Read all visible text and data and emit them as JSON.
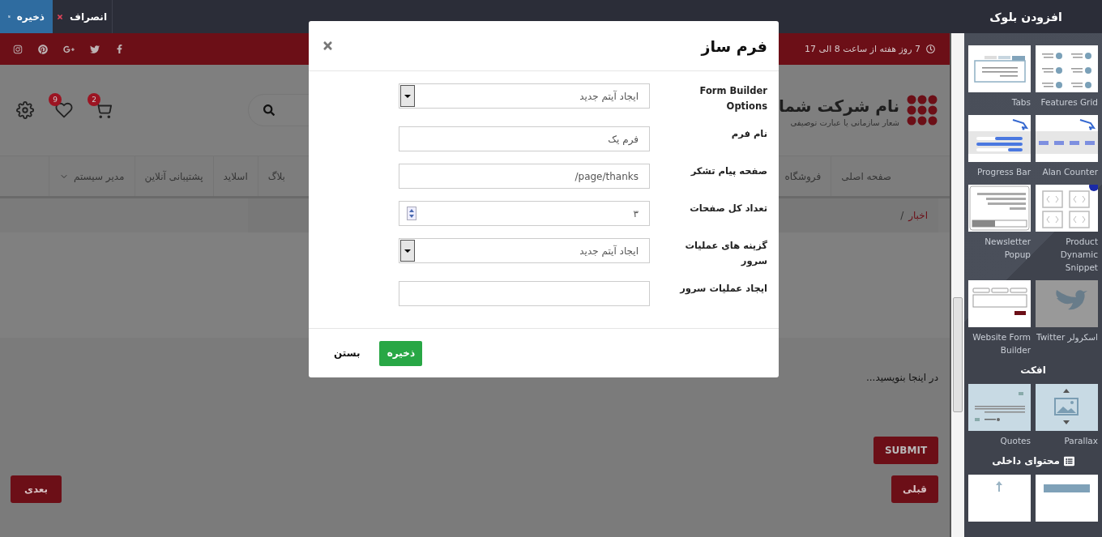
{
  "toolbar": {
    "save": "ذخیره",
    "cancel": "انصراف"
  },
  "topbar": {
    "hours": "7 روز هفته از ساعت 8 الی 17"
  },
  "header": {
    "logo_title": "نام شرکت شما",
    "logo_tagline": "شعار سازمانی یا عبارت توصیفی",
    "wishlist_count": "9",
    "cart_count": "2"
  },
  "nav": [
    {
      "label": "صفحه اصلی",
      "has_menu": false
    },
    {
      "label": "فروشگاه",
      "has_menu": false
    },
    {
      "label": "بلاگ",
      "has_menu": false
    },
    {
      "label": "اسلاید",
      "has_menu": false
    },
    {
      "label": "پشتیبانی آنلاین",
      "has_menu": false
    },
    {
      "label": "مدیر سیستم",
      "has_menu": true
    }
  ],
  "breadcrumb": {
    "label": "اخبار",
    "separator": "/"
  },
  "editor_text": "در اینجا بنویسید...",
  "buttons": {
    "submit": "SUBMIT",
    "previous": "قبلی",
    "next": "بعدی"
  },
  "modal": {
    "title": "فرم ساز",
    "fields": [
      {
        "label": "Form Builder Options",
        "kind": "select",
        "value": "ایجاد آیتم جدید"
      },
      {
        "label": "نام فرم",
        "kind": "text",
        "value": "فرم یک"
      },
      {
        "label": "صفحه پیام تشکر",
        "kind": "text",
        "value": "page/thanks/"
      },
      {
        "label": "تعداد کل صفحات",
        "kind": "number",
        "value": "۳"
      },
      {
        "label": "گزینه های عملیات سرور",
        "kind": "select",
        "value": "ایجاد آیتم جدید"
      },
      {
        "label": "ایجاد عملیات سرور",
        "kind": "text"
      }
    ],
    "save": "ذخیره",
    "close": "بستن"
  },
  "sidebar": {
    "title": "افزودن بلوک",
    "sections": [
      {
        "blocks": [
          {
            "kind": "features",
            "label": "Features Grid"
          },
          {
            "kind": "tabs",
            "label": "Tabs"
          },
          {
            "kind": "counter",
            "label": "Alan Counter"
          },
          {
            "kind": "progress",
            "label": "Progress Bar"
          },
          {
            "kind": "snippet",
            "label": "Product Dynamic Snippet"
          },
          {
            "kind": "newsletter",
            "label": "Newsletter Popup"
          },
          {
            "kind": "twitter",
            "label": "اسکرولر Twitter"
          },
          {
            "kind": "form",
            "label": "Website Form Builder"
          }
        ]
      },
      {
        "title": "افکت",
        "blocks": [
          {
            "kind": "parallax",
            "label": "Parallax"
          },
          {
            "kind": "quotes",
            "label": "Quotes"
          }
        ]
      },
      {
        "title": "محتوای داخلی",
        "blocks": [
          {
            "kind": "banner"
          },
          {
            "kind": "upload"
          }
        ]
      }
    ]
  }
}
